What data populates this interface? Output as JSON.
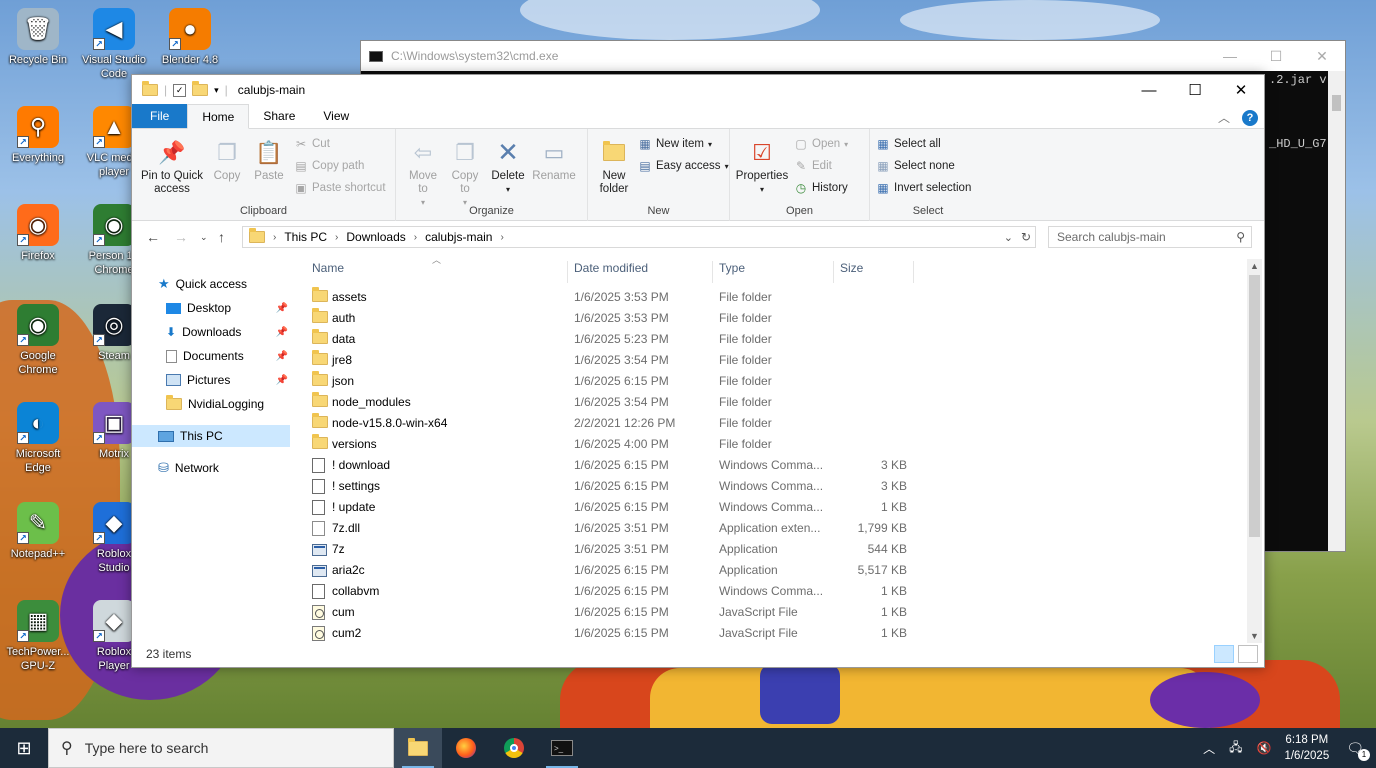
{
  "desktop": {
    "icons": [
      {
        "label": "Recycle Bin",
        "glyph": "🗑",
        "color": "#9fb6c8"
      },
      {
        "label": "Visual Studio Code",
        "glyph": "◀",
        "color": "#1e88e5"
      },
      {
        "label": "Blender 4.8",
        "glyph": "●",
        "color": "#f57c00"
      },
      {
        "label": "Everything",
        "glyph": "⚲",
        "color": "#ff7a00"
      },
      {
        "label": "VLC media player",
        "glyph": "▲",
        "color": "#ff8800"
      },
      {
        "label": "Firefox",
        "glyph": "◉",
        "color": "#ff6b1a"
      },
      {
        "label": "Person 1 - Chrome",
        "glyph": "◉",
        "color": "#2e7d32"
      },
      {
        "label": "Google Chrome",
        "glyph": "◉",
        "color": "#2e7d32"
      },
      {
        "label": "Steam",
        "glyph": "◎",
        "color": "#1b2838"
      },
      {
        "label": "Microsoft Edge",
        "glyph": "◐",
        "color": "#0b84d6"
      },
      {
        "label": "Motrix",
        "glyph": "▣",
        "color": "#7e57c2"
      },
      {
        "label": "Notepad++",
        "glyph": "✎",
        "color": "#6cbf4a"
      },
      {
        "label": "Roblox Studio",
        "glyph": "◆",
        "color": "#1e6fd9"
      },
      {
        "label": "TechPower... GPU-Z",
        "glyph": "▦",
        "color": "#3c8d3c"
      },
      {
        "label": "Roblox Player",
        "glyph": "◆",
        "color": "#cfd8dc"
      }
    ]
  },
  "cmd": {
    "title": "C:\\Windows\\system32\\cmd.exe",
    "line1": ".2.jar v",
    "line2": "_HD_U_G7"
  },
  "explorer": {
    "title": "calubjs-main",
    "tabs": {
      "file": "File",
      "home": "Home",
      "share": "Share",
      "view": "View"
    },
    "ribbon": {
      "clipboard": {
        "pin": "Pin to Quick access",
        "copy": "Copy",
        "paste": "Paste",
        "cut": "Cut",
        "copy_path": "Copy path",
        "paste_shortcut": "Paste shortcut",
        "label": "Clipboard"
      },
      "organize": {
        "move_to": "Move to",
        "copy_to": "Copy to",
        "delete": "Delete",
        "rename": "Rename",
        "label": "Organize"
      },
      "new": {
        "new_folder": "New folder",
        "new_item": "New item",
        "easy_access": "Easy access",
        "label": "New"
      },
      "open": {
        "properties": "Properties",
        "open": "Open",
        "edit": "Edit",
        "history": "History",
        "label": "Open"
      },
      "select": {
        "select_all": "Select all",
        "select_none": "Select none",
        "invert": "Invert selection",
        "label": "Select"
      }
    },
    "breadcrumb": [
      "This PC",
      "Downloads",
      "calubjs-main"
    ],
    "search_placeholder": "Search calubjs-main",
    "nav": {
      "quick_access": "Quick access",
      "desktop": "Desktop",
      "downloads": "Downloads",
      "documents": "Documents",
      "pictures": "Pictures",
      "nvidia": "NvidiaLogging",
      "this_pc": "This PC",
      "network": "Network"
    },
    "columns": {
      "name": "Name",
      "date": "Date modified",
      "type": "Type",
      "size": "Size"
    },
    "rows": [
      {
        "name": "assets",
        "date": "1/6/2025 3:53 PM",
        "type": "File folder",
        "size": "",
        "kind": "folder"
      },
      {
        "name": "auth",
        "date": "1/6/2025 3:53 PM",
        "type": "File folder",
        "size": "",
        "kind": "folder"
      },
      {
        "name": "data",
        "date": "1/6/2025 5:23 PM",
        "type": "File folder",
        "size": "",
        "kind": "folder"
      },
      {
        "name": "jre8",
        "date": "1/6/2025 3:54 PM",
        "type": "File folder",
        "size": "",
        "kind": "folder"
      },
      {
        "name": "json",
        "date": "1/6/2025 6:15 PM",
        "type": "File folder",
        "size": "",
        "kind": "folder"
      },
      {
        "name": "node_modules",
        "date": "1/6/2025 3:54 PM",
        "type": "File folder",
        "size": "",
        "kind": "folder"
      },
      {
        "name": "node-v15.8.0-win-x64",
        "date": "2/2/2021 12:26 PM",
        "type": "File folder",
        "size": "",
        "kind": "folder"
      },
      {
        "name": "versions",
        "date": "1/6/2025 4:00 PM",
        "type": "File folder",
        "size": "",
        "kind": "folder"
      },
      {
        "name": "! download",
        "date": "1/6/2025 6:15 PM",
        "type": "Windows Comma...",
        "size": "3 KB",
        "kind": "cmd"
      },
      {
        "name": "! settings",
        "date": "1/6/2025 6:15 PM",
        "type": "Windows Comma...",
        "size": "3 KB",
        "kind": "cmd"
      },
      {
        "name": "! update",
        "date": "1/6/2025 6:15 PM",
        "type": "Windows Comma...",
        "size": "1 KB",
        "kind": "cmd"
      },
      {
        "name": "7z.dll",
        "date": "1/6/2025 3:51 PM",
        "type": "Application exten...",
        "size": "1,799 KB",
        "kind": "file"
      },
      {
        "name": "7z",
        "date": "1/6/2025 3:51 PM",
        "type": "Application",
        "size": "544 KB",
        "kind": "app"
      },
      {
        "name": "aria2c",
        "date": "1/6/2025 6:15 PM",
        "type": "Application",
        "size": "5,517 KB",
        "kind": "app"
      },
      {
        "name": "collabvm",
        "date": "1/6/2025 6:15 PM",
        "type": "Windows Comma...",
        "size": "1 KB",
        "kind": "cmd"
      },
      {
        "name": "cum",
        "date": "1/6/2025 6:15 PM",
        "type": "JavaScript File",
        "size": "1 KB",
        "kind": "js"
      },
      {
        "name": "cum2",
        "date": "1/6/2025 6:15 PM",
        "type": "JavaScript File",
        "size": "1 KB",
        "kind": "js"
      }
    ],
    "status": "23 items"
  },
  "taskbar": {
    "search_placeholder": "Type here to search",
    "time": "6:18 PM",
    "date": "1/6/2025",
    "notification_count": "1"
  }
}
